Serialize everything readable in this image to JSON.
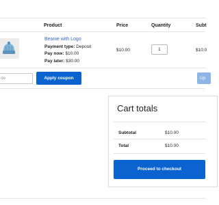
{
  "cart_table": {
    "headers": {
      "product": "Product",
      "price": "Price",
      "quantity": "Quantity",
      "subtotal": "Subt"
    },
    "row": {
      "product_name": "Beanie with Logo",
      "payment_type_label": "Payment type:",
      "payment_type_value": "Deposit",
      "pay_now_label": "Pay now:",
      "pay_now_value": "$10.00",
      "pay_later_label": "Pay later:",
      "pay_later_value": "$30.00",
      "price": "$10.00",
      "quantity": "1",
      "subtotal": "$10.0"
    }
  },
  "coupon": {
    "input_placeholder": "de",
    "apply_label": "Apply coupon",
    "update_label": "Up"
  },
  "cart_totals": {
    "title": "Cart totals",
    "subtotal_label": "Subtotal",
    "subtotal_value": "$10.00",
    "total_label": "Total",
    "total_value": "$10.00",
    "checkout_label": "Proceed to checkout"
  },
  "colors": {
    "accent": "#0b63cf",
    "link": "#3368c8",
    "disabled_button": "#8eb5e6"
  }
}
